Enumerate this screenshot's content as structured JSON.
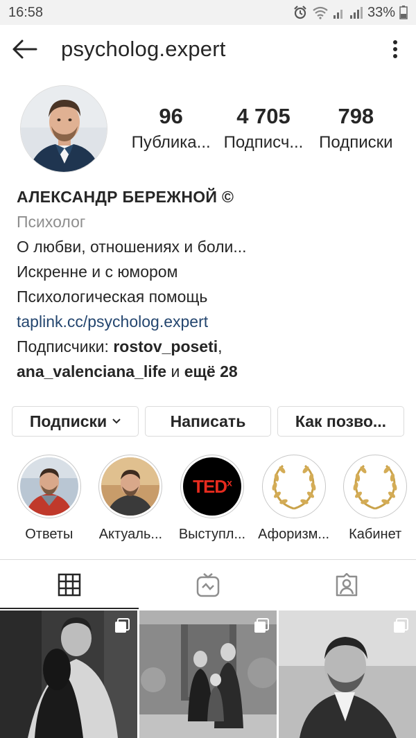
{
  "status_bar": {
    "time": "16:58",
    "battery": "33%",
    "icons": [
      "alarm-icon",
      "wifi-icon",
      "signal-icon",
      "signal-icon",
      "battery-icon"
    ]
  },
  "header": {
    "username": "psycholog.expert",
    "icons": [
      "back-arrow-icon",
      "more-vertical-icon"
    ]
  },
  "profile": {
    "stats": [
      {
        "value": "96",
        "label": "Публика..."
      },
      {
        "value": "4 705",
        "label": "Подписч..."
      },
      {
        "value": "798",
        "label": "Подписки"
      }
    ],
    "name": "АЛЕКСАНДР БЕРЕЖНОЙ ©",
    "category": "Психолог",
    "bio_lines": [
      "О любви, отношениях и боли...",
      "Искренне и с юмором",
      "Психологическая помощь"
    ],
    "link": "taplink.cc/psycholog.expert",
    "followed_by": {
      "prefix": "Подписчики: ",
      "user1": "rostov_poseti",
      "sep": ",",
      "user2": "ana_valenciana_life",
      "mid": " и ",
      "more": "ещё 28"
    }
  },
  "actions": {
    "following": "Подписки",
    "message": "Написать",
    "contact": "Как позво..."
  },
  "highlights": [
    {
      "label": "Ответы"
    },
    {
      "label": "Актуаль..."
    },
    {
      "label": "Выступл...",
      "badge": "TED",
      "badge_sup": "x"
    },
    {
      "label": "Афоризм..."
    },
    {
      "label": "Кабинет"
    }
  ],
  "tabs": [
    "grid-icon",
    "igtv-icon",
    "tagged-icon"
  ],
  "colors": {
    "link": "#24466f",
    "secondary_text": "#8e8e8e",
    "ted_red": "#e62b1e",
    "border": "#dbdbdb"
  }
}
